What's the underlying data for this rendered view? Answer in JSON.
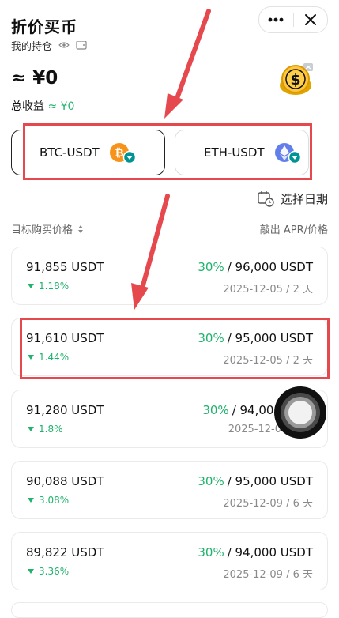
{
  "header": {
    "title": "折价买币"
  },
  "holdings": {
    "label": "我的持仓"
  },
  "balance": {
    "value": "≈ ¥0"
  },
  "total_pnl": {
    "label": "总收益",
    "value": "≈ ¥0"
  },
  "pairs": [
    {
      "label": "BTC-USDT",
      "coin": "btc-icon",
      "active": true
    },
    {
      "label": "ETH-USDT",
      "coin": "eth-icon",
      "active": false
    }
  ],
  "date_selector": {
    "label": "选择日期"
  },
  "list_header": {
    "left": "目标购买价格",
    "right": "敲出 APR/价格"
  },
  "orders": [
    {
      "price": "91,855 USDT",
      "change": "1.18%",
      "apr": "30%",
      "strike": "/ 96,000 USDT",
      "date": "2025-12-05 / 2 天"
    },
    {
      "price": "91,610 USDT",
      "change": "1.44%",
      "apr": "30%",
      "strike": "/ 95,000 USDT",
      "date": "2025-12-05 / 2 天"
    },
    {
      "price": "91,280 USDT",
      "change": "1.8%",
      "apr": "30%",
      "strike": "/ 94,000",
      "date": "2025-12-0"
    },
    {
      "price": "90,088 USDT",
      "change": "3.08%",
      "apr": "30%",
      "strike": "/ 95,000 USDT",
      "date": "2025-12-09 / 6 天"
    },
    {
      "price": "89,822 USDT",
      "change": "3.36%",
      "apr": "30%",
      "strike": "/ 94,000 USDT",
      "date": "2025-12-09 / 6 天"
    }
  ],
  "colors": {
    "accent_green": "#20b26c",
    "annotation_red": "#e5484d",
    "btc_orange": "#f7931a",
    "eth_purple": "#627eea"
  }
}
